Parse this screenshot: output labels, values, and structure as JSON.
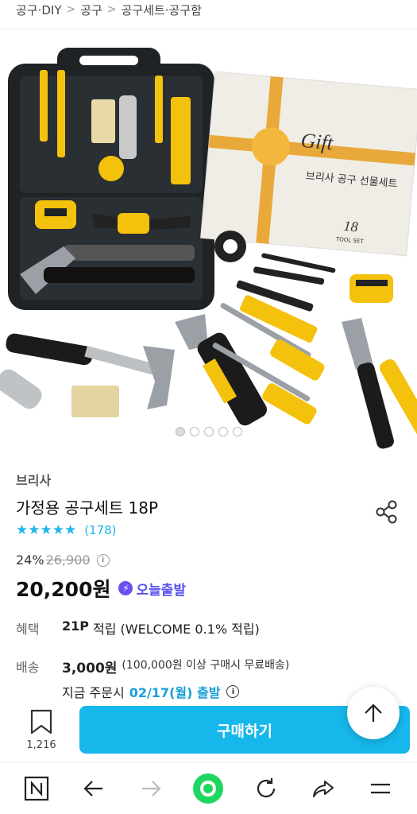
{
  "breadcrumb": [
    "공구·DIY",
    "공구",
    "공구세트·공구함"
  ],
  "breadcrumb_sep": ">",
  "product": {
    "brand": "브리사",
    "title": "가정용 공구세트 18P",
    "stars": "★★★★★",
    "review_count": "(178)",
    "discount": "24%",
    "original_price": "26,900",
    "sale_price": "20,200원",
    "today_shipping": "오늘출발",
    "image_index": 1,
    "image_total": 5
  },
  "box_text": {
    "gift": "Gift",
    "set_name": "브리사 공구 선물세트",
    "count": "18",
    "suffix": "TOOL SET"
  },
  "benefit": {
    "label": "혜택",
    "points": "21P",
    "text": "적립 (WELCOME 0.1% 적립)"
  },
  "shipping": {
    "label": "배송",
    "fee": "3,000원",
    "note": "(100,000원 이상 구매시 무료배송)",
    "eta_prefix": "지금 주문시",
    "eta_date": "02/17(월) 출발"
  },
  "bottom": {
    "bookmark_count": "1,216",
    "buy_label": "구매하기"
  },
  "colors": {
    "accent": "#16b7ea",
    "today": "#5b52f0",
    "date": "#1a9ed8"
  },
  "icons": {
    "share": "share-icon",
    "bookmark": "bookmark-icon",
    "top": "arrow-up-icon",
    "nav": [
      "naver-icon",
      "back-icon",
      "forward-icon",
      "home-dot-icon",
      "refresh-icon",
      "share-arrow-icon",
      "menu-icon"
    ]
  }
}
